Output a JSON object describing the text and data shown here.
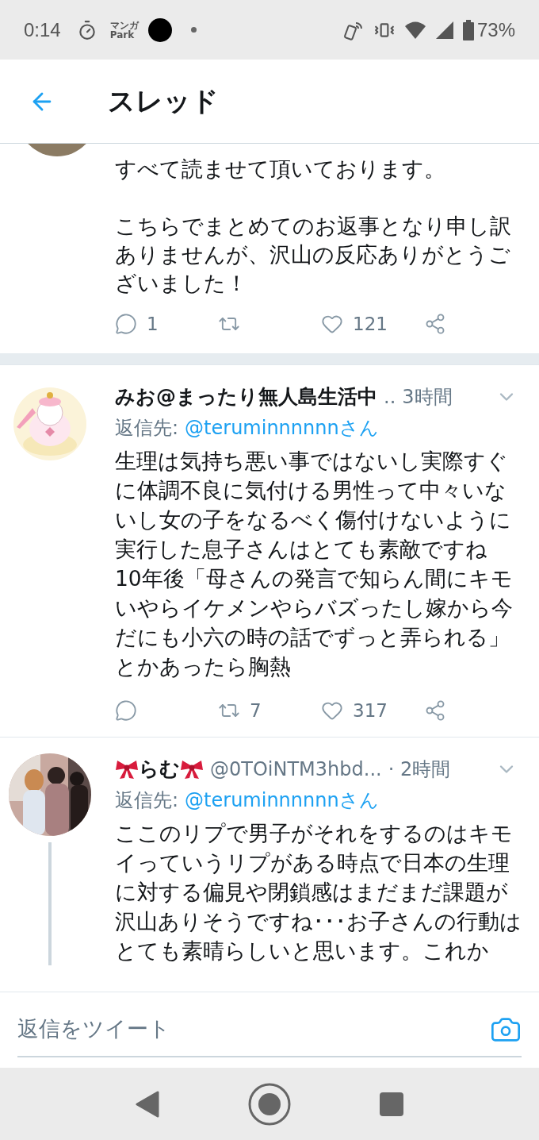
{
  "status_bar": {
    "time": "0:14",
    "app_label_top": "マンガ",
    "app_label_bottom": "Park",
    "battery": "73%"
  },
  "header": {
    "title": "スレッド"
  },
  "tweets": [
    {
      "kind": "continued",
      "paragraphs": [
        "すべて読ませて頂いております。",
        "こちらでまとめてのお返事となり申し訳ありませんが、沢山の反応ありがとうございました！"
      ],
      "counts": {
        "reply": "1",
        "like": "121"
      }
    },
    {
      "kind": "full",
      "name": "みお@まったり無人島生活中",
      "handle": "..",
      "time": "3時間",
      "reply_label": "返信先:",
      "reply_to": "@teruminnnnnnさん",
      "paragraphs": [
        "生理は気持ち悪い事ではないし実際すぐに体調不良に気付ける男性って中々いないし女の子をなるべく傷付けないように実行した息子さんはとても素敵ですね",
        "10年後「母さんの発言で知らん間にキモいやらイケメンやらバズったし嫁から今だにも小六の時の話でずっと弄られる」とかあったら胸熱"
      ],
      "counts": {
        "retweet": "7",
        "like": "317"
      },
      "ribbons": false,
      "thread": false
    },
    {
      "kind": "full",
      "name": "らむ",
      "handle": "@0TOiNTM3hbd...",
      "time": "· 2時間",
      "reply_label": "返信先:",
      "reply_to": "@teruminnnnnnさん",
      "paragraphs": [
        "ここのリプで男子がそれをするのはキモイっていうリプがある時点で日本の生理に対する偏見や閉鎖感はまだまだ課題が沢山ありそうですね･･･お子さんの行動はとても素晴らしいと思います。これか"
      ],
      "ribbons": true,
      "thread": true
    }
  ],
  "reply_bar": {
    "placeholder": "返信をツイート"
  }
}
